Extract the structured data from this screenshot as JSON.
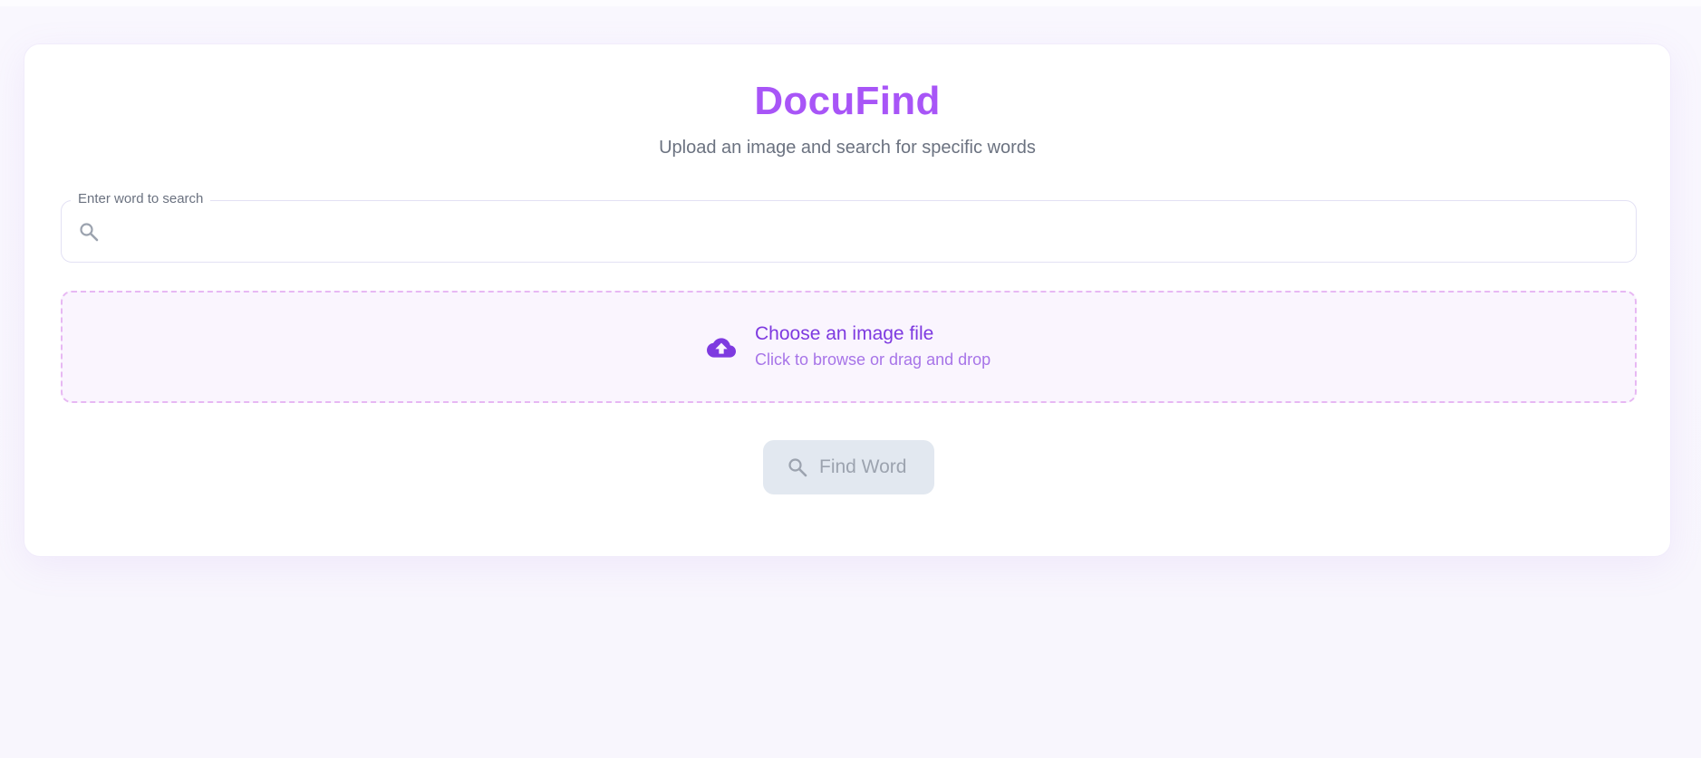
{
  "app": {
    "title": "DocuFind",
    "subtitle": "Upload an image and search for specific words"
  },
  "search": {
    "label": "Enter word to search",
    "value": "",
    "placeholder": "",
    "icon": "search-icon"
  },
  "upload": {
    "title": "Choose an image file",
    "hint": "Click to browse or drag and drop",
    "icon": "cloud-upload-icon"
  },
  "actions": {
    "find_label": "Find Word",
    "find_icon": "search-icon",
    "find_disabled": true
  },
  "colors": {
    "brand": "#a855f7",
    "upload_text": "#7e3ae0",
    "upload_border": "#e7b8f3",
    "disabled_button": "#e2e8f0"
  }
}
